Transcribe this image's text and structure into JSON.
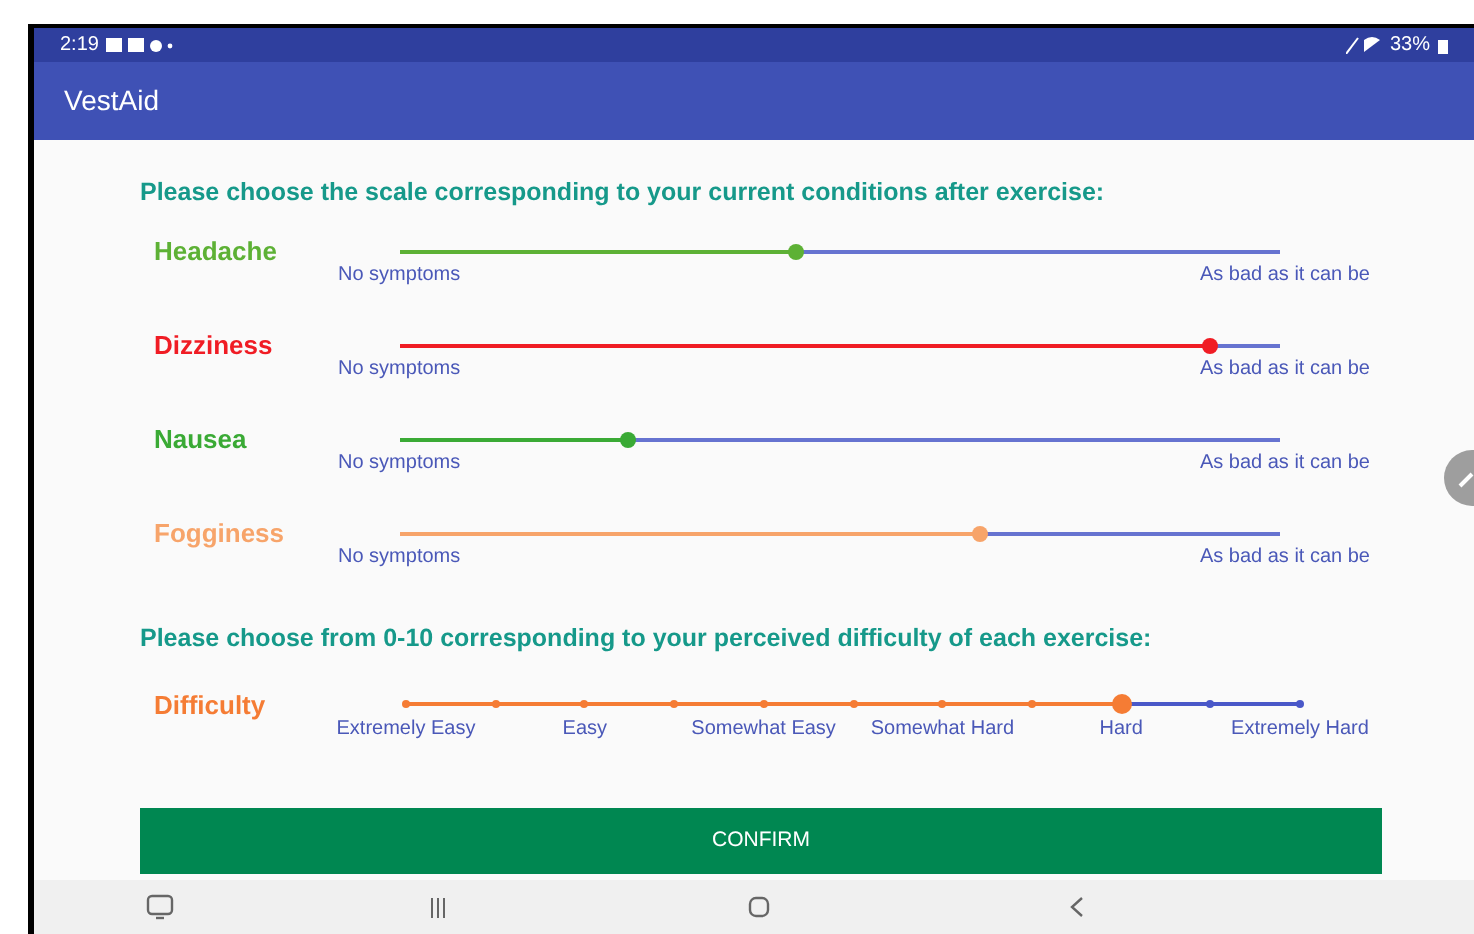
{
  "status_bar": {
    "time": "2:19",
    "battery": "33%"
  },
  "app_bar": {
    "title": "VestAid"
  },
  "symptoms": {
    "heading": "Please choose the scale corresponding to your current conditions after exercise:",
    "rows": [
      {
        "label": "Headache",
        "color": "#5db135",
        "level": 0.45,
        "min_label": "No symptoms",
        "max_label": "As bad as it can be"
      },
      {
        "label": "Dizziness",
        "color": "#f01c24",
        "level": 0.92,
        "min_label": "No symptoms",
        "max_label": "As bad as it can be"
      },
      {
        "label": "Nausea",
        "color": "#3aaa35",
        "level": 0.26,
        "min_label": "No symptoms",
        "max_label": "As bad as it can be"
      },
      {
        "label": "Fogginess",
        "color": "#f7a46a",
        "level": 0.66,
        "min_label": "No symptoms",
        "max_label": "As bad as it can be"
      }
    ]
  },
  "difficulty": {
    "heading": "Please choose from 0-10 corresponding to your perceived difficulty of each exercise:",
    "label": "Difficulty",
    "level": 0.8,
    "scale_labels": [
      "Extremely Easy",
      "Easy",
      "Somewhat Easy",
      "Somewhat Hard",
      "Hard",
      "Extremely Hard"
    ]
  },
  "confirm_button": {
    "label": "CONFIRM"
  }
}
